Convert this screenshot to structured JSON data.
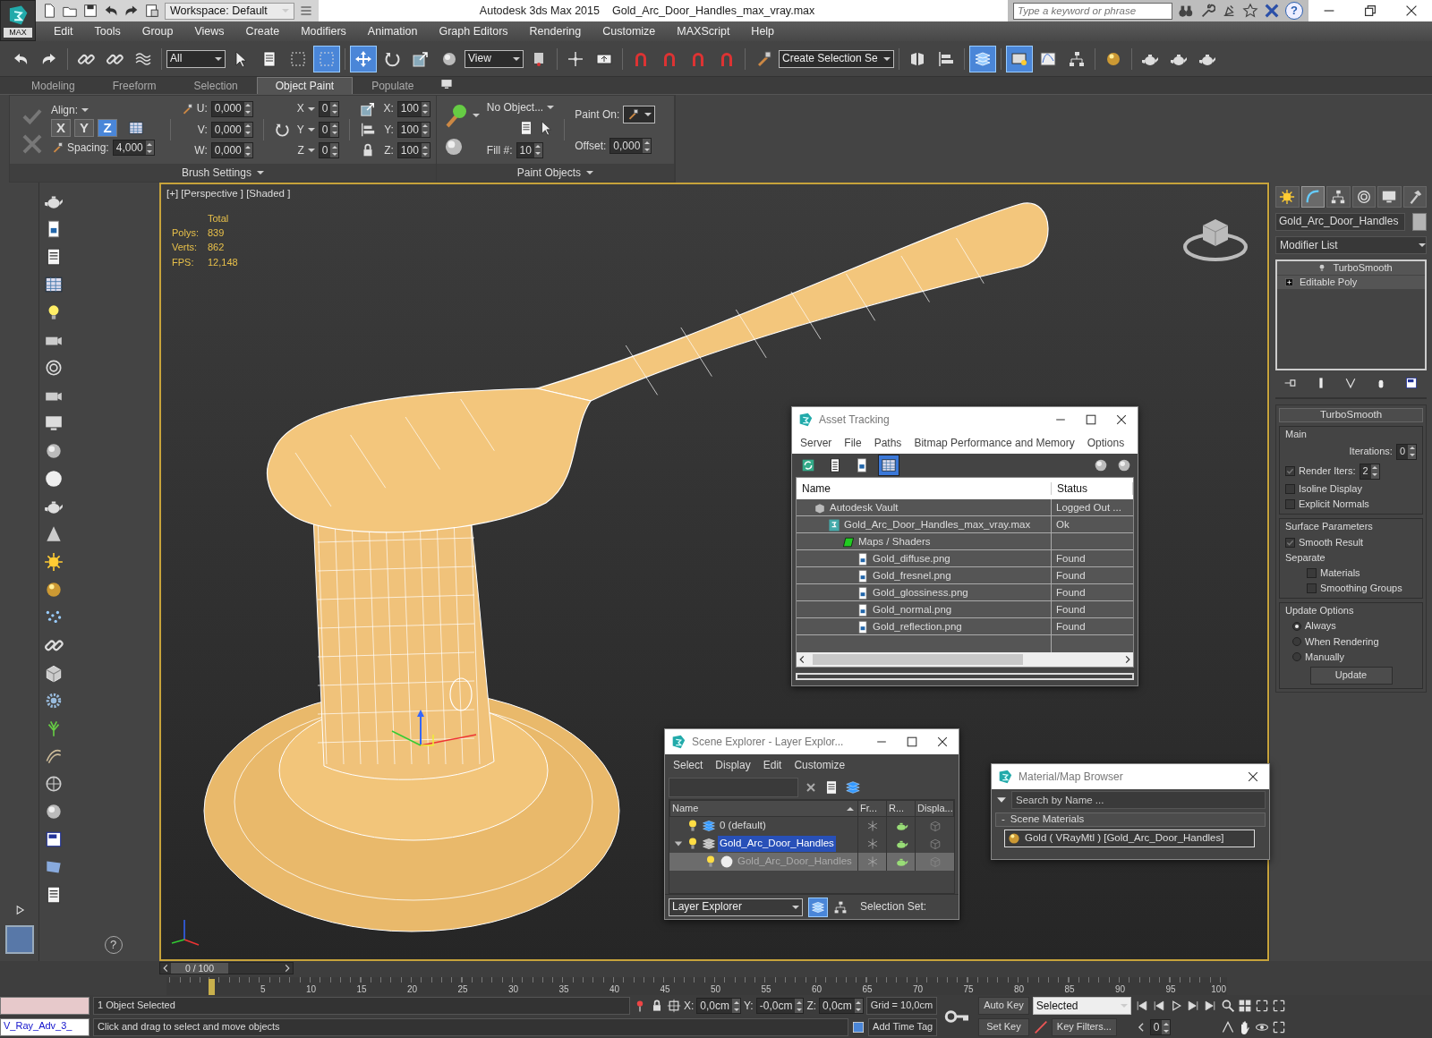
{
  "title_bar": {
    "app_label": "MAX",
    "workspace": "Workspace: Default",
    "app_title": "Autodesk 3ds Max  2015",
    "file_name": "Gold_Arc_Door_Handles_max_vray.max",
    "search_placeholder": "Type a keyword or phrase",
    "help_glyph": "?"
  },
  "menu": [
    "Edit",
    "Tools",
    "Group",
    "Views",
    "Create",
    "Modifiers",
    "Animation",
    "Graph Editors",
    "Rendering",
    "Customize",
    "MAXScript",
    "Help"
  ],
  "main_toolbar": {
    "items": [
      {
        "kind": "button",
        "active": false
      },
      {
        "kind": "button",
        "active": false
      },
      {
        "kind": "separator"
      },
      {
        "kind": "button",
        "active": false
      },
      {
        "kind": "button",
        "active": false
      },
      {
        "kind": "button",
        "active": false
      },
      {
        "kind": "separator"
      },
      {
        "kind": "dropdown",
        "value": "All"
      },
      {
        "kind": "button",
        "active": false
      },
      {
        "kind": "button",
        "active": false
      },
      {
        "kind": "button",
        "active": false
      },
      {
        "kind": "button",
        "active": true
      },
      {
        "kind": "separator"
      },
      {
        "kind": "button",
        "active": true
      },
      {
        "kind": "button",
        "active": false
      },
      {
        "kind": "button",
        "active": false
      },
      {
        "kind": "button",
        "active": false
      },
      {
        "kind": "dropdown",
        "value": "View"
      },
      {
        "kind": "button",
        "active": false
      },
      {
        "kind": "separator"
      },
      {
        "kind": "button",
        "active": false
      },
      {
        "kind": "button",
        "active": false
      },
      {
        "kind": "separator"
      },
      {
        "kind": "button",
        "active": false
      },
      {
        "kind": "button",
        "active": false
      },
      {
        "kind": "button",
        "active": false
      },
      {
        "kind": "button",
        "active": false
      },
      {
        "kind": "separator"
      },
      {
        "kind": "button",
        "active": false
      },
      {
        "kind": "dropdown",
        "value": "Create Selection Se"
      },
      {
        "kind": "separator"
      },
      {
        "kind": "button",
        "active": false
      },
      {
        "kind": "button",
        "active": false
      },
      {
        "kind": "separator"
      },
      {
        "kind": "button",
        "active": true
      },
      {
        "kind": "separator"
      },
      {
        "kind": "button",
        "active": true
      },
      {
        "kind": "button",
        "active": false
      },
      {
        "kind": "button",
        "active": false
      },
      {
        "kind": "separator"
      },
      {
        "kind": "button",
        "active": false
      },
      {
        "kind": "separator"
      },
      {
        "kind": "button",
        "active": false
      },
      {
        "kind": "button",
        "active": false
      },
      {
        "kind": "button",
        "active": false
      }
    ]
  },
  "ribbon": {
    "tabs": [
      {
        "label": "Modeling",
        "selected": false
      },
      {
        "label": "Freeform",
        "selected": false
      },
      {
        "label": "Selection",
        "selected": false
      },
      {
        "label": "Object Paint",
        "selected": true
      },
      {
        "label": "Populate",
        "selected": false
      }
    ],
    "align_label": "Align:",
    "axes": [
      {
        "label": "X",
        "selected": false
      },
      {
        "label": "Y",
        "selected": false
      },
      {
        "label": "Z",
        "selected": true
      }
    ],
    "spacing": {
      "label": "Spacing:",
      "value": "4,000"
    },
    "offset_fields": [
      {
        "label": "U:",
        "value": "0,000"
      },
      {
        "label": "V:",
        "value": "0,000"
      },
      {
        "label": "W:",
        "value": "0,000"
      }
    ],
    "rotate_fields": [
      {
        "label": "X",
        "value": "0"
      },
      {
        "label": "Y",
        "value": "0"
      },
      {
        "label": "Z",
        "value": "0"
      }
    ],
    "scale_fields": [
      {
        "label": "X:",
        "value": "100"
      },
      {
        "label": "Y:",
        "value": "100"
      },
      {
        "label": "Z:",
        "value": "100"
      }
    ],
    "brush_settings": "Brush Settings",
    "object_dropdown": "No Object...",
    "fill": {
      "label": "Fill #:",
      "value": "10"
    },
    "paint_on": "Paint On:",
    "offset": {
      "label": "Offset:",
      "value": "0,000"
    },
    "paint_objects": "Paint Objects"
  },
  "viewport": {
    "label": "[+] [Perspective ] [Shaded ]",
    "stats": [
      {
        "value": "Total"
      },
      {
        "label": "Polys:",
        "value": "839"
      },
      {
        "label": "Verts:",
        "value": "862"
      },
      {
        "label": "FPS:",
        "value": "12,148"
      }
    ]
  },
  "command_panel": {
    "tabs": [
      {
        "selected": false
      },
      {
        "selected": true
      },
      {
        "selected": false
      },
      {
        "selected": false
      },
      {
        "selected": false
      },
      {
        "selected": false
      }
    ],
    "object_name": "Gold_Arc_Door_Handles",
    "modifier_list": "Modifier List",
    "stack": [
      {
        "label": "TurboSmooth",
        "kind": "modifier"
      },
      {
        "label": "Editable Poly",
        "kind": "base"
      }
    ],
    "rollout_title": "TurboSmooth",
    "main_group": {
      "title": "Main",
      "iterations": {
        "label": "Iterations:",
        "value": "0"
      },
      "render_iters": {
        "label": "Render Iters:",
        "value": "2",
        "checked": true
      },
      "options": [
        {
          "label": "Isoline Display",
          "checked": false
        },
        {
          "label": "Explicit Normals",
          "checked": false
        }
      ]
    },
    "surface_group": {
      "title": "Surface Parameters",
      "smooth_result": {
        "label": "Smooth Result",
        "checked": true
      },
      "separate_label": "Separate",
      "separate": [
        {
          "label": "Materials",
          "checked": false
        },
        {
          "label": "Smoothing Groups",
          "checked": false
        }
      ]
    },
    "update_group": {
      "title": "Update Options",
      "options": [
        {
          "label": "Always",
          "selected": true
        },
        {
          "label": "When Rendering",
          "selected": false
        },
        {
          "label": "Manually",
          "selected": false
        }
      ],
      "button": "Update"
    }
  },
  "asset_tracking": {
    "title": "Asset Tracking",
    "menu": [
      "Server",
      "File",
      "Paths",
      "Bitmap Performance and Memory",
      "Options"
    ],
    "toolbar": [
      {
        "selected": false
      },
      {
        "selected": false
      },
      {
        "selected": false
      },
      {
        "selected": true
      }
    ],
    "columns": [
      "Name",
      "Status"
    ],
    "rows": [
      {
        "kind": "vault",
        "name": "Autodesk Vault",
        "status": "Logged Out ...",
        "children": [
          {
            "kind": "scene",
            "name": "Gold_Arc_Door_Handles_max_vray.max",
            "status": "Ok",
            "children": [
              {
                "kind": "folder",
                "name": "Maps / Shaders",
                "children": [
                  {
                    "kind": "bitmap",
                    "name": "Gold_diffuse.png",
                    "status": "Found"
                  },
                  {
                    "kind": "bitmap",
                    "name": "Gold_fresnel.png",
                    "status": "Found"
                  },
                  {
                    "kind": "bitmap",
                    "name": "Gold_glossiness.png",
                    "status": "Found"
                  },
                  {
                    "kind": "bitmap",
                    "name": "Gold_normal.png",
                    "status": "Found"
                  },
                  {
                    "kind": "bitmap",
                    "name": "Gold_reflection.png",
                    "status": "Found"
                  }
                ]
              }
            ]
          }
        ]
      }
    ]
  },
  "scene_explorer": {
    "title": "Scene Explorer - Layer Explor...",
    "menu": [
      "Select",
      "Display",
      "Edit",
      "Customize"
    ],
    "columns": [
      "Name",
      "Fr...",
      "R...",
      "Displa..."
    ],
    "rows": [
      {
        "kind": "layer",
        "name": "0 (default)",
        "selected": false
      },
      {
        "kind": "layer",
        "name": "Gold_Arc_Door_Handles",
        "selected": true,
        "expanded": true,
        "children": [
          {
            "kind": "object",
            "name": "Gold_Arc_Door_Handles",
            "selected": true
          }
        ]
      }
    ],
    "explorer_dropdown": "Layer Explorer",
    "selection_set_label": "Selection Set:"
  },
  "material_browser": {
    "title": "Material/Map Browser",
    "search_placeholder": "Search by Name ...",
    "group_toggle": "-",
    "group": "Scene Materials",
    "items": [
      "Gold ( VRayMtl ) [Gold_Arc_Door_Handles]"
    ]
  },
  "timeline": {
    "position": "0 / 100",
    "tick_labels": [
      "5",
      "10",
      "15",
      "20",
      "25",
      "30",
      "35",
      "40",
      "45",
      "50",
      "55",
      "60",
      "65",
      "70",
      "75",
      "80",
      "85",
      "90",
      "95",
      "100"
    ]
  },
  "status_bar": {
    "listener_bottom": "V_Ray_Adv_3_",
    "selection": "1 Object Selected",
    "prompt": "Click and drag to select and move objects",
    "coords": [
      {
        "label": "X:",
        "value": "0,0cm"
      },
      {
        "label": "Y:",
        "value": "-0,0cm"
      },
      {
        "label": "Z:",
        "value": "0,0cm"
      }
    ],
    "grid": "Grid = 10,0cm",
    "time_tag": "Add Time Tag",
    "auto_key": "Auto Key",
    "set_key": "Set Key",
    "key_mode": "Selected",
    "key_filters": "Key Filters...",
    "frame": "0",
    "help_glyph": "?"
  }
}
